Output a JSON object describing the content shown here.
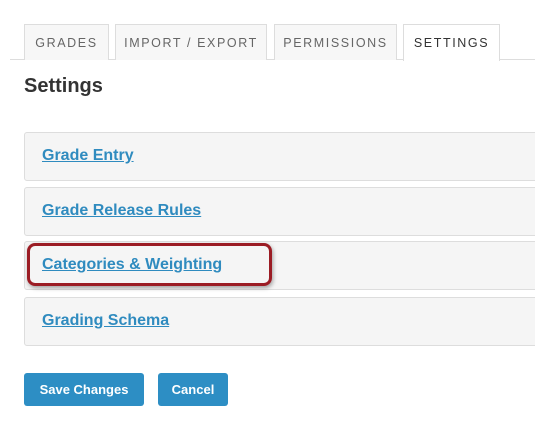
{
  "tabs": [
    {
      "label": "GRADES",
      "active": false
    },
    {
      "label": "IMPORT / EXPORT",
      "active": false
    },
    {
      "label": "PERMISSIONS",
      "active": false
    },
    {
      "label": "SETTINGS",
      "active": true
    }
  ],
  "page": {
    "title": "Settings"
  },
  "panels": [
    {
      "label": "Grade Entry"
    },
    {
      "label": "Grade Release Rules"
    },
    {
      "label": "Categories & Weighting",
      "highlighted": true
    },
    {
      "label": "Grading Schema"
    }
  ],
  "actions": {
    "save_label": "Save Changes",
    "cancel_label": "Cancel"
  },
  "colors": {
    "link": "#2f8bbf",
    "button": "#2d8ec4",
    "highlight": "#9b1c24"
  }
}
